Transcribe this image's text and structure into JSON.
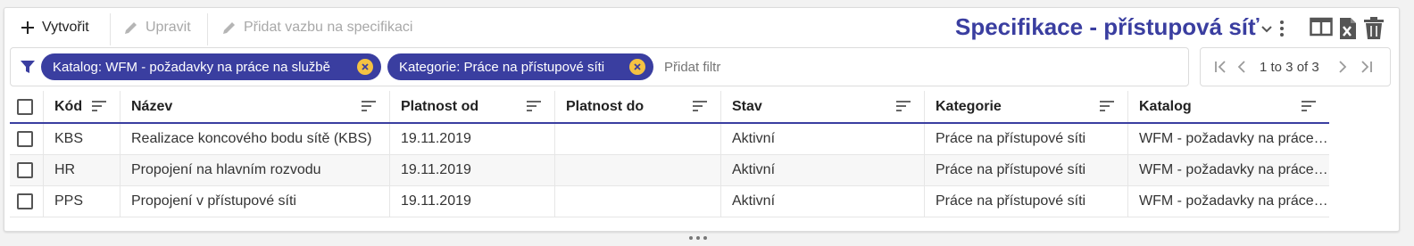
{
  "toolbar": {
    "create_label": "Vytvořit",
    "edit_label": "Upravit",
    "add_link_label": "Přidat vazbu na specifikaci"
  },
  "title": "Specifikace - přístupová síť",
  "filters": {
    "chips": [
      {
        "label": "Katalog: WFM - požadavky na práce na službě"
      },
      {
        "label": "Kategorie: Práce na přístupové síti"
      }
    ],
    "placeholder": "Přidat filtr"
  },
  "pager": {
    "range_text": "1 to 3 of 3"
  },
  "table": {
    "columns": [
      "Kód",
      "Název",
      "Platnost od",
      "Platnost do",
      "Stav",
      "Kategorie",
      "Katalog"
    ],
    "rows": [
      [
        "KBS",
        "Realizace koncového bodu sítě (KBS)",
        "19.11.2019",
        "",
        "Aktivní",
        "Práce na přístupové síti",
        "WFM - požadavky na práce…"
      ],
      [
        "HR",
        "Propojení na hlavním rozvodu",
        "19.11.2019",
        "",
        "Aktivní",
        "Práce na přístupové síti",
        "WFM - požadavky na práce…"
      ],
      [
        "PPS",
        "Propojení v přístupové síti",
        "19.11.2019",
        "",
        "Aktivní",
        "Práce na přístupové síti",
        "WFM - požadavky na práce…"
      ]
    ]
  },
  "colors": {
    "accent": "#3a3ea0",
    "chip_close": "#f5c242",
    "disabled": "#a8a8a8"
  },
  "icons": [
    "plus-icon",
    "pencil-icon",
    "filter-icon",
    "close-icon",
    "chevron-down-icon",
    "more-vert-icon",
    "columns-icon",
    "excel-export-icon",
    "trash-icon",
    "first-page-icon",
    "prev-page-icon",
    "next-page-icon",
    "last-page-icon",
    "sort-icon",
    "drag-handle-icon"
  ]
}
